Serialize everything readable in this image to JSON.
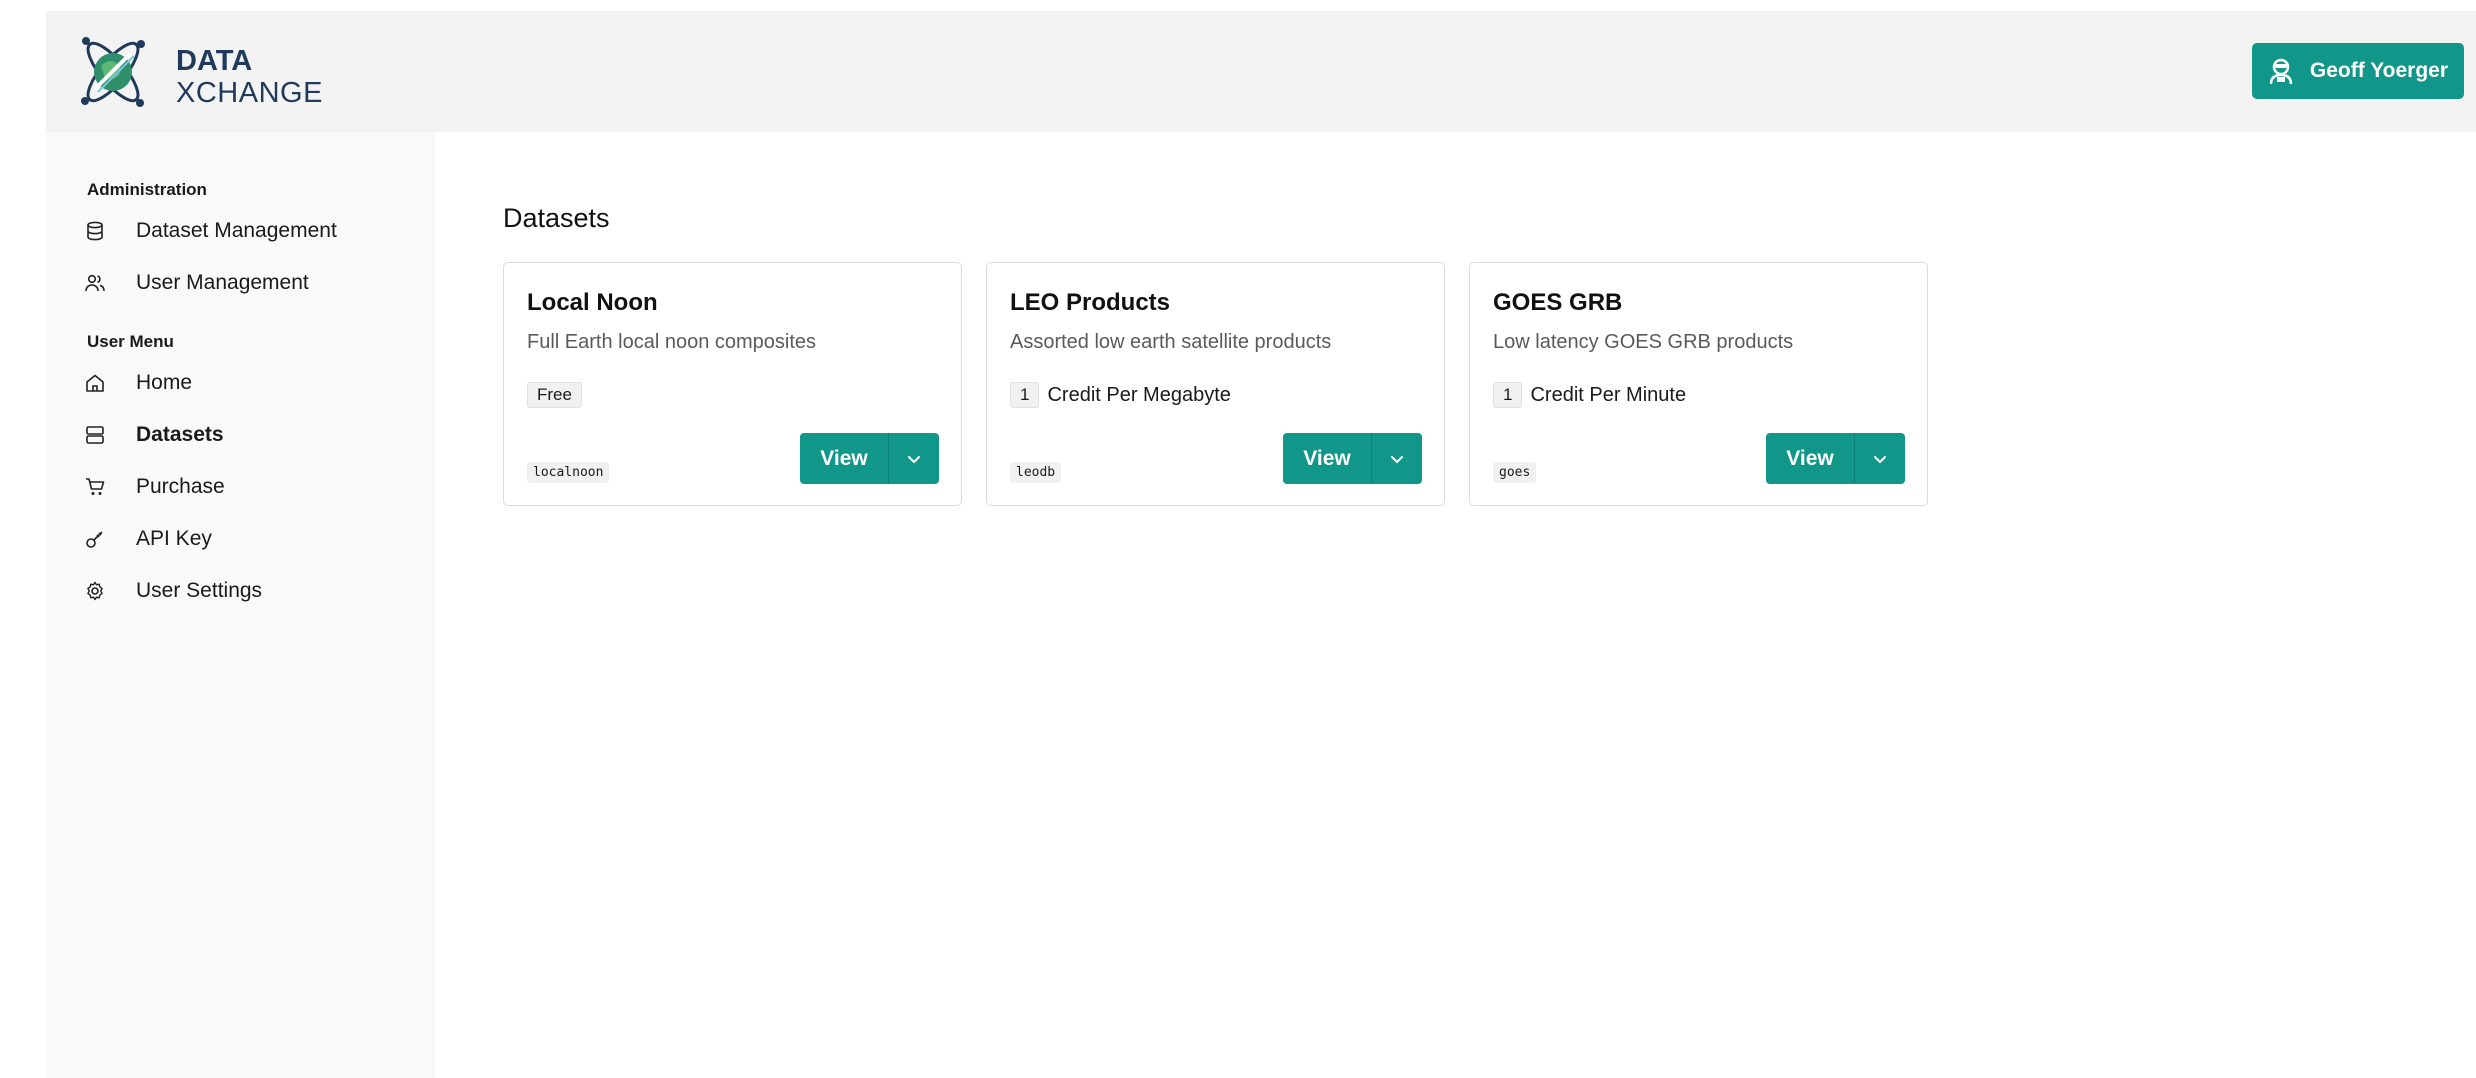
{
  "brand": {
    "line1": "DATA",
    "line2": "XCHANGE"
  },
  "header": {
    "user_name": "Geoff Yoerger"
  },
  "sidebar": {
    "sections": [
      {
        "heading": "Administration"
      },
      {
        "heading": "User Menu"
      }
    ],
    "items": [
      {
        "label": "Dataset Management",
        "icon": "database-icon"
      },
      {
        "label": "User Management",
        "icon": "users-icon"
      },
      {
        "label": "Home",
        "icon": "home-icon"
      },
      {
        "label": "Datasets",
        "icon": "server-icon",
        "active": true
      },
      {
        "label": "Purchase",
        "icon": "cart-icon"
      },
      {
        "label": "API Key",
        "icon": "key-icon"
      },
      {
        "label": "User Settings",
        "icon": "gear-icon"
      }
    ]
  },
  "main": {
    "title": "Datasets",
    "cards": [
      {
        "title": "Local Noon",
        "description": "Full Earth local noon composites",
        "price_badge": "Free",
        "price_text": "",
        "slug": "localnoon",
        "view_label": "View"
      },
      {
        "title": "LEO Products",
        "description": "Assorted low earth satellite products",
        "price_badge": "1",
        "price_text": "Credit Per Megabyte",
        "slug": "leodb",
        "view_label": "View"
      },
      {
        "title": "GOES GRB",
        "description": "Low latency GOES GRB products",
        "price_badge": "1",
        "price_text": "Credit Per Minute",
        "slug": "goes",
        "view_label": "View"
      }
    ]
  },
  "colors": {
    "accent": "#11968a",
    "brand_text": "#1f3a5a",
    "topbar": "#f3f3f3",
    "sidebar": "#f9f9f9"
  }
}
